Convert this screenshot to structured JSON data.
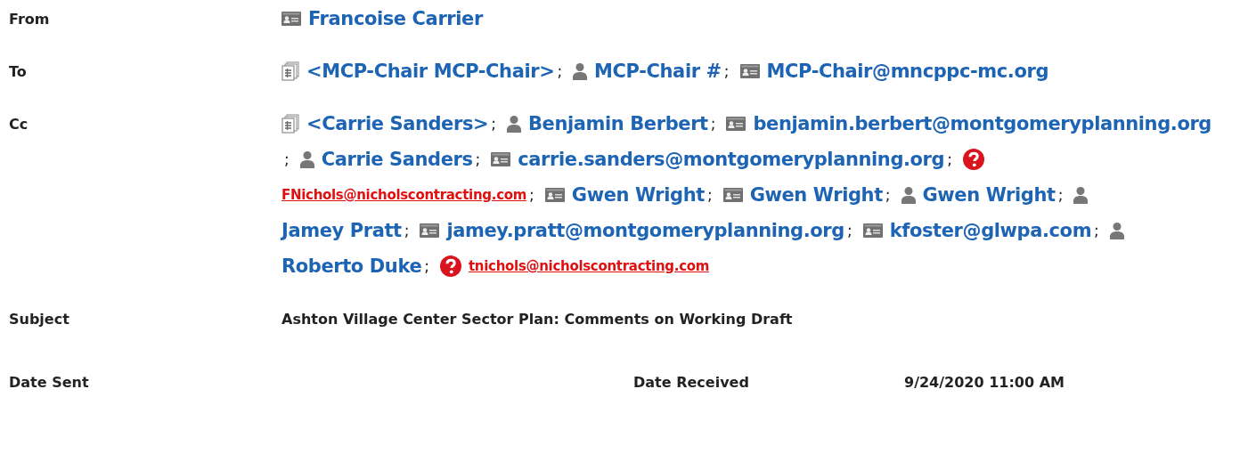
{
  "from": {
    "label": "From",
    "recipients": [
      {
        "kind": "card",
        "name": "Francoise Carrier"
      }
    ]
  },
  "to": {
    "label": "To",
    "recipients": [
      {
        "kind": "group",
        "name": "<MCP-Chair MCP-Chair>",
        "separator": ";"
      },
      {
        "kind": "person",
        "name": "MCP-Chair #",
        "separator": ";"
      },
      {
        "kind": "card",
        "name": "MCP-Chair@mncppc-mc.org"
      }
    ]
  },
  "cc": {
    "label": "Cc",
    "recipients": [
      {
        "kind": "group",
        "name": "<Carrie Sanders>",
        "separator": ";"
      },
      {
        "kind": "person",
        "name": "Benjamin Berbert",
        "separator": ";"
      },
      {
        "kind": "card",
        "name": "benjamin.berbert@montgomeryplanning.org",
        "separator": ";"
      },
      {
        "kind": "person",
        "name": "Carrie Sanders",
        "separator": ";"
      },
      {
        "kind": "card",
        "name": "carrie.sanders@montgomeryplanning.org",
        "separator": ";"
      },
      {
        "kind": "unresolved",
        "name": "FNichols@nicholscontracting.com",
        "separator": ";"
      },
      {
        "kind": "card",
        "name": "Gwen Wright",
        "separator": ";"
      },
      {
        "kind": "card",
        "name": "Gwen Wright",
        "separator": ";"
      },
      {
        "kind": "person",
        "name": "Gwen Wright",
        "separator": ";"
      },
      {
        "kind": "person",
        "name": "Jamey Pratt",
        "separator": ";"
      },
      {
        "kind": "card",
        "name": "jamey.pratt@montgomeryplanning.org",
        "separator": ";"
      },
      {
        "kind": "card",
        "name": "kfoster@glwpa.com",
        "separator": ";"
      },
      {
        "kind": "person",
        "name": "Roberto Duke",
        "separator": ";"
      },
      {
        "kind": "unresolved",
        "name": "tnichols@nicholscontracting.com"
      }
    ]
  },
  "subject": {
    "label": "Subject",
    "value": "Ashton Village Center Sector Plan: Comments on Working Draft"
  },
  "dates": {
    "sent_label": "Date Sent",
    "received_label": "Date Received",
    "received_value": "9/24/2020 11:00 AM"
  }
}
